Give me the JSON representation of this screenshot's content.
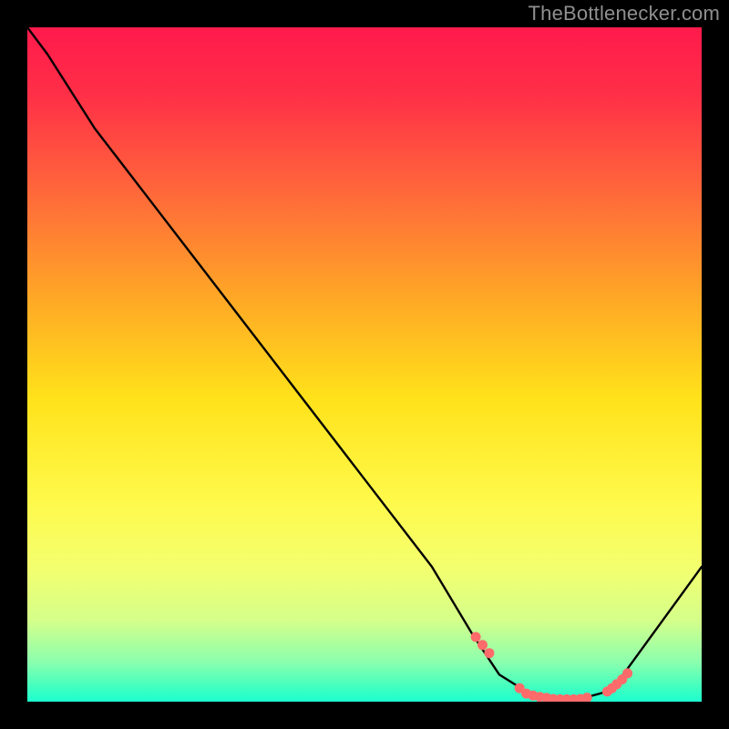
{
  "source_label": "TheBottlenecker.com",
  "colors": {
    "frame": "#000000",
    "curve": "#000000",
    "marker_fill": "#ff6b6b",
    "label": "#8f8f8f"
  },
  "chart_data": {
    "type": "line",
    "title": "",
    "xlabel": "",
    "ylabel": "",
    "xlim": [
      0,
      100
    ],
    "ylim": [
      0,
      100
    ],
    "x": [
      0,
      3,
      10,
      20,
      30,
      40,
      50,
      60,
      66,
      70,
      74,
      78,
      82,
      86,
      88,
      100
    ],
    "values": [
      100,
      96,
      85,
      72,
      59,
      46,
      33,
      20,
      10,
      4,
      1.5,
      0.4,
      0.4,
      1.5,
      3.5,
      20
    ],
    "markers": {
      "x": [
        66.5,
        67.5,
        68.5,
        73,
        74,
        75,
        76,
        77,
        78,
        79,
        80,
        81,
        82,
        83,
        86,
        86.7,
        87.4,
        88.2,
        89
      ],
      "y": [
        9.6,
        8.4,
        7.2,
        2.0,
        1.2,
        0.9,
        0.7,
        0.55,
        0.4,
        0.35,
        0.35,
        0.35,
        0.4,
        0.6,
        1.5,
        2.0,
        2.6,
        3.3,
        4.2
      ]
    },
    "gradient_stops": [
      {
        "offset": 0.0,
        "color": "#ff1a4c"
      },
      {
        "offset": 0.1,
        "color": "#ff2f47"
      },
      {
        "offset": 0.25,
        "color": "#ff6a3a"
      },
      {
        "offset": 0.4,
        "color": "#ffa726"
      },
      {
        "offset": 0.55,
        "color": "#ffe21a"
      },
      {
        "offset": 0.7,
        "color": "#fff94a"
      },
      {
        "offset": 0.8,
        "color": "#f4ff6e"
      },
      {
        "offset": 0.88,
        "color": "#d4ff8a"
      },
      {
        "offset": 0.94,
        "color": "#8dffad"
      },
      {
        "offset": 0.98,
        "color": "#3effc0"
      },
      {
        "offset": 1.0,
        "color": "#1cffd0"
      }
    ]
  }
}
